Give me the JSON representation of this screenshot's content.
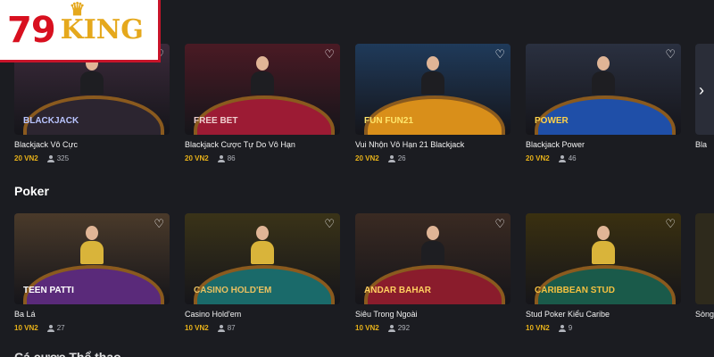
{
  "brand": {
    "number": "79",
    "name": "KING"
  },
  "icons": {
    "favorite": "heart-icon",
    "players": "person-icon",
    "next": "chevron-right-icon",
    "crown": "crown-icon"
  },
  "sections": [
    {
      "title": "",
      "cards": [
        {
          "title": "Blackjack Vô Cực",
          "bet": "20 VN2",
          "players": "325",
          "badge": "BLACKJACK",
          "bg": "#3b2a3a",
          "felt": "#2c2530",
          "badge_color": "#b9c4ff"
        },
        {
          "title": "Blackjack Cược Tự Do Vô Hạn",
          "bet": "20 VN2",
          "players": "86",
          "badge": "FREE BET",
          "bg": "#4a1a24",
          "felt": "#9c1b34",
          "badge_color": "#f0d0d0"
        },
        {
          "title": "Vui Nhộn Vô Hạn 21 Blackjack",
          "bet": "20 VN2",
          "players": "26",
          "badge": "FUN FUN21",
          "bg": "#1f3a5a",
          "felt": "#d98f1a",
          "badge_color": "#ffe66b"
        },
        {
          "title": "Blackjack Power",
          "bet": "20 VN2",
          "players": "46",
          "badge": "POWER",
          "bg": "#2a3040",
          "felt": "#1f4fa8",
          "badge_color": "#ffd24a"
        }
      ],
      "peek": {
        "title": "Bla"
      }
    },
    {
      "title": "Poker",
      "cards": [
        {
          "title": "Ba Lá",
          "bet": "10 VN2",
          "players": "27",
          "badge": "TEEN PATTI",
          "bg": "#4a3a2a",
          "felt": "#5a2a7a",
          "badge_color": "#ffffff"
        },
        {
          "title": "Casino Hold'em",
          "bet": "10 VN2",
          "players": "87",
          "badge": "CASINO HOLD'EM",
          "bg": "#3a3318",
          "felt": "#1a6a6a",
          "badge_color": "#e8c060"
        },
        {
          "title": "Siêu Trong Ngoài",
          "bet": "10 VN2",
          "players": "292",
          "badge": "ANDAR BAHAR",
          "bg": "#3a2a22",
          "felt": "#8a1c2c",
          "badge_color": "#ffd060"
        },
        {
          "title": "Stud Poker Kiểu Caribe",
          "bet": "10 VN2",
          "players": "9",
          "badge": "CARIBBEAN STUD",
          "bg": "#3a3010",
          "felt": "#1a5a4a",
          "badge_color": "#f4c040"
        }
      ],
      "peek": {
        "title": "Sòng"
      }
    }
  ],
  "next_section": {
    "title": "Cá cược Thể thao"
  }
}
